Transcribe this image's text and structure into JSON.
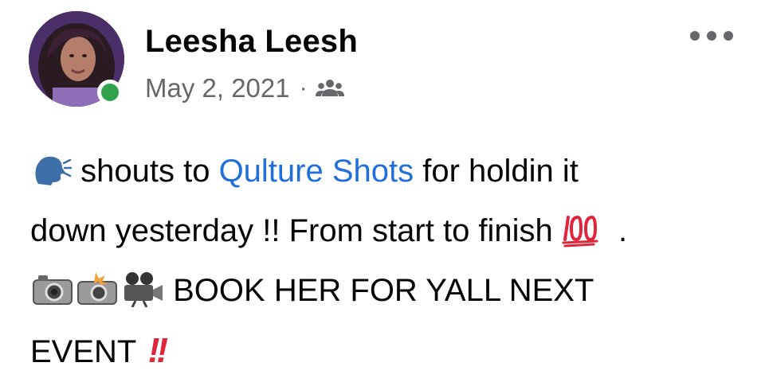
{
  "post": {
    "author": "Leesha Leesh",
    "date": "May 2, 2021",
    "separator": "·",
    "audience_icon": "friends-icon",
    "more_icon": "more-options-icon",
    "online": true,
    "text": {
      "line1_after_emoji": " shouts to ",
      "mention": "Qulture Shots",
      "line1_tail": " for holdin it",
      "line2": "down yesterday !! From start to finish ",
      "line2_tail": " .",
      "line3": " BOOK HER FOR YALL NEXT",
      "line4": "EVENT ",
      "bangs": "!!"
    },
    "emojis": [
      "speaking-head-icon",
      "hundred-points-icon",
      "camera-icon",
      "camera-flash-icon",
      "video-camera-icon",
      "double-exclamation-icon"
    ]
  },
  "colors": {
    "accent_link": "#216fdb",
    "meta_gray": "#65676b",
    "online_green": "#31a24c",
    "exclamation_red": "#e0243a"
  }
}
